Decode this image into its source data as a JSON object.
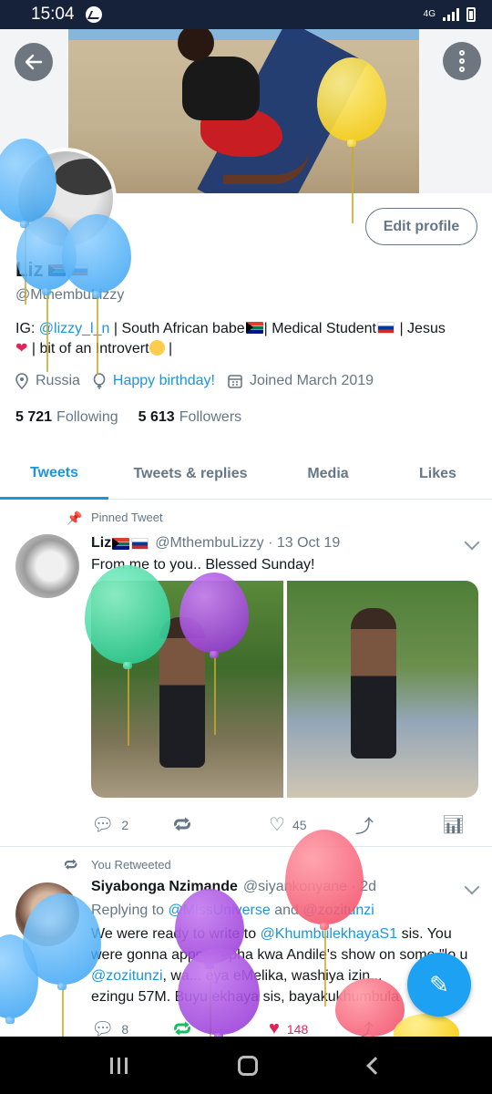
{
  "status_bar": {
    "time": "15:04",
    "network": "4G"
  },
  "profile": {
    "name": "Liz",
    "handle": "@MthembuLizzy",
    "edit_button": "Edit profile",
    "bio": {
      "prefix": "IG: ",
      "ig_link": "@lizzy_l_n",
      "part1": " | South African babe",
      "part2": "| Medical Student",
      "part3": " | Jesus",
      "part4": " | bit of an Introvert",
      "part5": " |"
    },
    "location": "Russia",
    "birthday": "Happy birthday!",
    "joined": "Joined March 2019",
    "following_count": "5 721",
    "following_label": "Following",
    "followers_count": "5 613",
    "followers_label": "Followers"
  },
  "tabs": [
    {
      "label": "Tweets",
      "active": true
    },
    {
      "label": "Tweets & replies",
      "active": false
    },
    {
      "label": "Media",
      "active": false
    },
    {
      "label": "Likes",
      "active": false
    }
  ],
  "tweets": [
    {
      "context": "Pinned Tweet",
      "name": "Liz",
      "handle": "@MthembuLizzy",
      "date": "· 13 Oct 19",
      "text": "From me to you.. Blessed Sunday!",
      "replies": "2",
      "retweets": "",
      "likes": "45"
    },
    {
      "context": "You Retweeted",
      "name": "Siyabonga Nzimande",
      "handle": "@siyankonyane",
      "date": "· 2d",
      "replying_prefix": "Replying to ",
      "replying_to_1": "@MissUniverse",
      "replying_and": " and ",
      "replying_to_2": "@zozitunzi",
      "text_line1_a": "We were ready to write to ",
      "text_line1_link": "@KhumbulekhayaS1",
      "text_line1_b": "  sis. You",
      "text_line2": "were gonna appear epha kwa Andile's show on some \"lo u",
      "text_line3_link": "@zozitunzi",
      "text_line3_b": ", wa... eya eMelika, washiya  izin...",
      "text_line4": "ezingu 57M. Buyu ekhaya sis, bayakukhumbula",
      "replies": "8",
      "retweets": "",
      "likes": "148"
    }
  ],
  "colors": {
    "accent": "#1b95e0",
    "like": "#e0245e",
    "retweet": "#17bf63"
  }
}
